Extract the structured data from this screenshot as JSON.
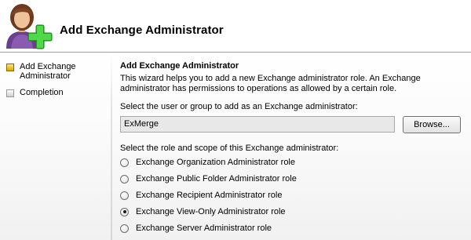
{
  "header": {
    "title": "Add Exchange Administrator"
  },
  "nav": {
    "items": [
      {
        "label": "Add Exchange Administrator",
        "state": "current"
      },
      {
        "label": "Completion",
        "state": "pending"
      }
    ]
  },
  "main": {
    "section_title": "Add Exchange Administrator",
    "description": "This wizard helps you to add a new Exchange administrator role.  An Exchange administrator has permissions to operations as allowed by a certain role.",
    "user_label": "Select the user or group to add as an Exchange administrator:",
    "user_value": "ExMerge",
    "browse_label": "Browse...",
    "role_label": "Select the role and scope of this Exchange administrator:",
    "roles": [
      {
        "label": "Exchange Organization Administrator role",
        "checked": false
      },
      {
        "label": "Exchange Public Folder Administrator role",
        "checked": false
      },
      {
        "label": "Exchange Recipient Administrator role",
        "checked": false
      },
      {
        "label": "Exchange View-Only Administrator role",
        "checked": true
      },
      {
        "label": "Exchange Server Administrator role",
        "checked": false
      }
    ]
  },
  "icons": {
    "header": "add-user-icon",
    "nav_current": "current-step-icon",
    "nav_pending": "pending-step-icon"
  },
  "colors": {
    "add_accent": "#2fb52a",
    "nav_current": "#e0a800"
  }
}
